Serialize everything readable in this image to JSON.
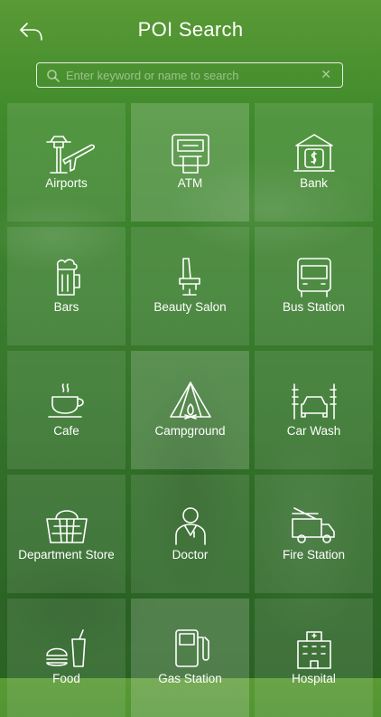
{
  "header": {
    "title": "POI Search",
    "back_icon": "back-arrow-icon"
  },
  "search": {
    "placeholder": "Enter keyword or name to search",
    "value": "",
    "search_icon": "search-icon",
    "clear_icon": "clear-icon"
  },
  "categories": [
    {
      "label": "Airports",
      "icon": "airport-icon"
    },
    {
      "label": "ATM",
      "icon": "atm-icon"
    },
    {
      "label": "Bank",
      "icon": "bank-icon"
    },
    {
      "label": "Bars",
      "icon": "beer-icon"
    },
    {
      "label": "Beauty Salon",
      "icon": "salon-chair-icon"
    },
    {
      "label": "Bus Station",
      "icon": "bus-icon"
    },
    {
      "label": "Cafe",
      "icon": "coffee-cup-icon"
    },
    {
      "label": "Campground",
      "icon": "tent-icon"
    },
    {
      "label": "Car Wash",
      "icon": "car-wash-icon"
    },
    {
      "label": "Department Store",
      "icon": "basket-icon"
    },
    {
      "label": "Doctor",
      "icon": "doctor-icon"
    },
    {
      "label": "Fire Station",
      "icon": "fire-truck-icon"
    },
    {
      "label": "Food",
      "icon": "food-icon"
    },
    {
      "label": "Gas Station",
      "icon": "gas-pump-icon"
    },
    {
      "label": "Hospital",
      "icon": "hospital-icon"
    }
  ],
  "colors": {
    "background": "#3a7d2e",
    "tile": "rgba(255,255,255,0.10)",
    "text": "#ffffff"
  }
}
